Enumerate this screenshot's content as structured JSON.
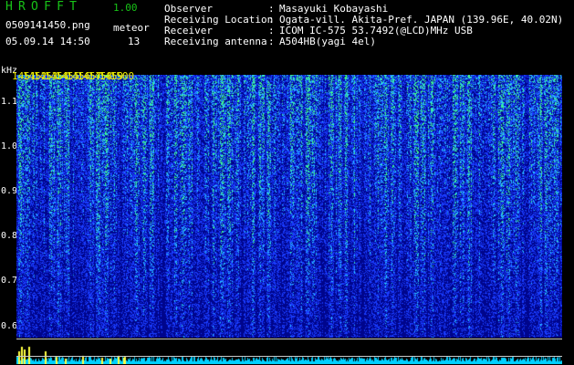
{
  "header": {
    "app_title": "HROFFT",
    "app_version": "1.00",
    "file_name": "0509141450.png",
    "capture_time": "05.09.14 14:50",
    "meteor_label": "meteor",
    "meteor_count": "13"
  },
  "station_info": [
    {
      "label": "Observer",
      "value": "Masayuki Kobayashi"
    },
    {
      "label": "Receiving Location",
      "value": "Ogata-vill. Akita-Pref. JAPAN (139.96E, 40.02N)"
    },
    {
      "label": "Receiver",
      "value": "ICOM IC-575 53.7492(@LCD)MHz USB"
    },
    {
      "label": "Receiving antenna",
      "value": "A504HB(yagi 4el)"
    }
  ],
  "separator": ":",
  "plot": {
    "y_unit": "kHz",
    "y_ticks": [
      "1.1",
      "1.0",
      "0.9",
      "0.8",
      "0.7",
      "0.6"
    ],
    "y_tick_values": [
      1.1,
      1.0,
      0.9,
      0.8,
      0.7,
      0.6
    ],
    "y_range": [
      0.575,
      1.16
    ],
    "time_labels": [
      "1451",
      "1452",
      "1453",
      "1454",
      "1455",
      "1456",
      "1457",
      "1458",
      "1459",
      "1500"
    ],
    "time_range_minutes": [
      1450,
      1500
    ],
    "spike_times": [
      1450.2,
      1450.4,
      1450.7,
      1451.1,
      1452.6,
      1453.6,
      1454.4,
      1456.0,
      1457.8,
      1458.5,
      1459.3,
      1459.8,
      1459.9
    ]
  },
  "colors": {
    "header_green": "#18c418",
    "header_white": "#ffffff",
    "time_label_yellow": "#f0f000",
    "spectrogram_background": "#00058c",
    "noise_blue": "#1a3cff",
    "noise_cyan": "#28c8ff",
    "noise_green": "#40ff80",
    "count_cyan": "#00d0ff",
    "spike_yellow": "#ffff40"
  }
}
